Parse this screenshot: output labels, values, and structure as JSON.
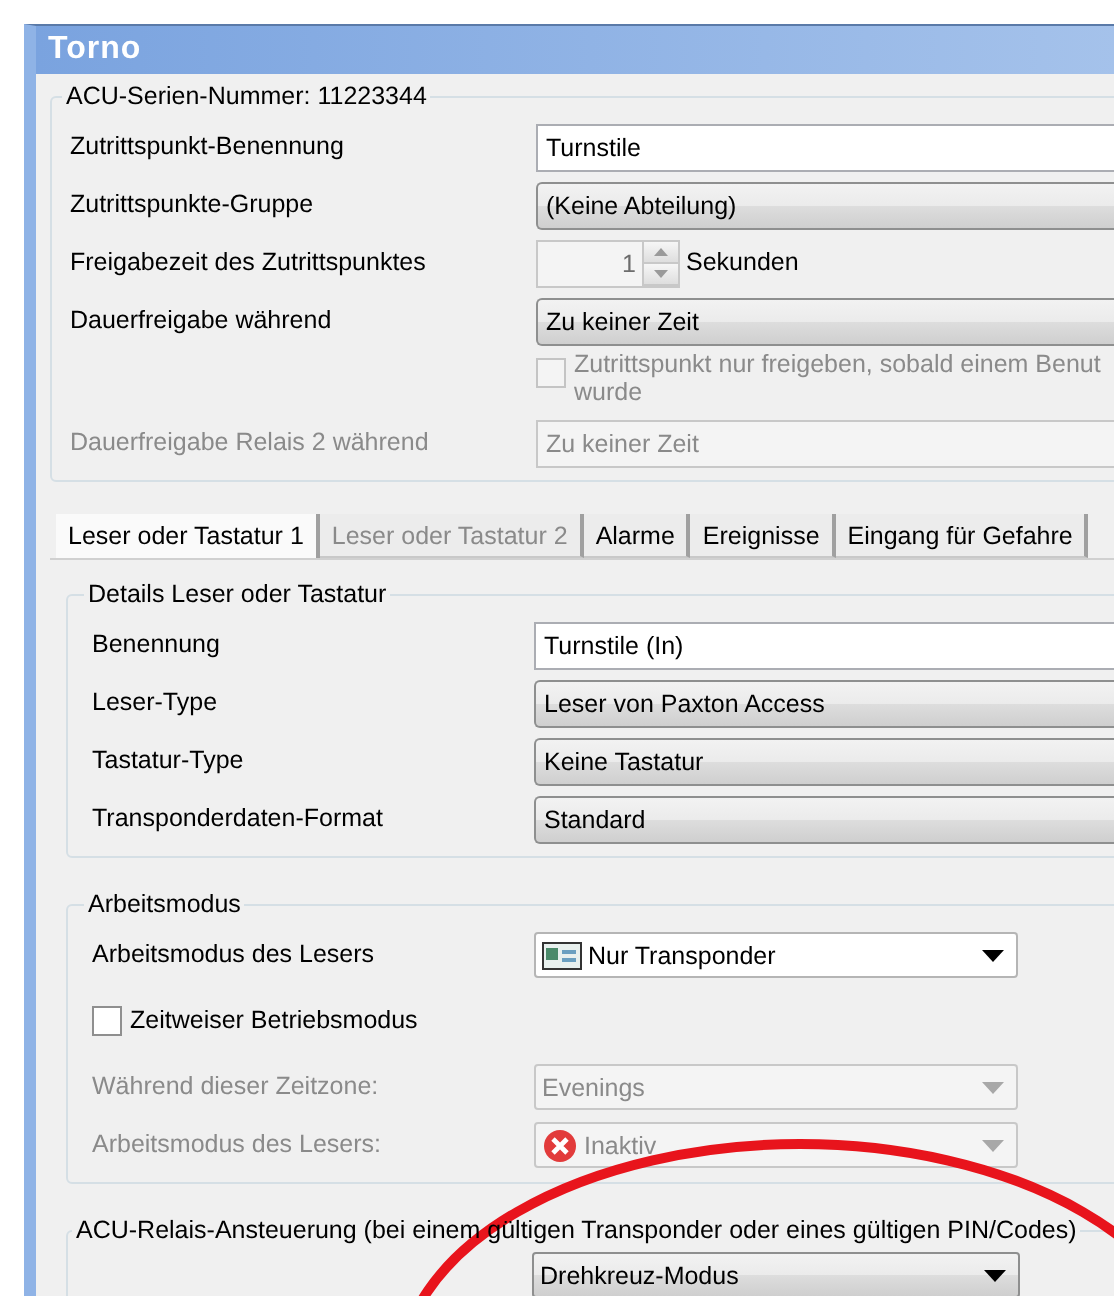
{
  "window": {
    "title": "Torno"
  },
  "serial_group": {
    "legend": "ACU-Serien-Nummer: 11223344",
    "rows": [
      {
        "kind": "text",
        "label": "Zutrittspunkt-Benennung",
        "value": "Turnstile"
      },
      {
        "kind": "combo",
        "label": "Zutrittspunkte-Gruppe",
        "value": "(Keine Abteilung)"
      },
      {
        "kind": "spinner",
        "label": "Freigabezeit des Zutrittspunktes",
        "value": "1",
        "unit": "Sekunden",
        "disabled": true
      },
      {
        "kind": "combo",
        "label": "Dauerfreigabe während",
        "value": "Zu keiner Zeit"
      }
    ],
    "option": {
      "lines": [
        "Zutrittspunkt nur freigeben, sobald einem Benut",
        "wurde"
      ],
      "checked": false,
      "disabled": true
    },
    "relay_row": {
      "label": "Dauerfreigabe Relais 2 während",
      "value": "Zu keiner Zeit",
      "disabled": true
    }
  },
  "tabs": [
    {
      "label": "Leser oder Tastatur 1",
      "selected": true,
      "disabled": false
    },
    {
      "label": "Leser oder Tastatur 2",
      "selected": false,
      "disabled": true
    },
    {
      "label": "Alarme",
      "selected": false,
      "disabled": false
    },
    {
      "label": "Ereignisse",
      "selected": false,
      "disabled": false
    },
    {
      "label": "Eingang für Gefahre",
      "selected": false,
      "disabled": false
    }
  ],
  "details": {
    "legend": "Details Leser oder Tastatur",
    "rows": [
      {
        "kind": "text",
        "label": "Benennung",
        "value": "Turnstile (In)"
      },
      {
        "kind": "combo",
        "label": "Leser-Type",
        "value": "Leser von Paxton Access"
      },
      {
        "kind": "combo",
        "label": "Tastatur-Type",
        "value": "Keine Tastatur"
      },
      {
        "kind": "combo",
        "label": "Transponderdaten-Format",
        "value": "Standard"
      }
    ]
  },
  "mode": {
    "legend": "Arbeitsmodus",
    "rows": [
      {
        "kind": "card-dropdown",
        "label": "Arbeitsmodus des Lesers",
        "value": "Nur Transponder",
        "disabled": false
      },
      {
        "kind": "checkbox",
        "label": "Zeitweiser Betriebsmodus",
        "checked": false
      },
      {
        "kind": "dropdown",
        "label": "Während dieser Zeitzone:",
        "value": "Evenings",
        "disabled": true
      },
      {
        "kind": "error-dropdown",
        "label": "Arbeitsmodus des Lesers:",
        "value": "Inaktiv",
        "disabled": true
      }
    ]
  },
  "relay": {
    "legend": "ACU-Relais-Ansteuerung (bei einem gültigen Transponder oder eines gültigen PIN/Codes)",
    "value": "Drehkreuz-Modus"
  }
}
